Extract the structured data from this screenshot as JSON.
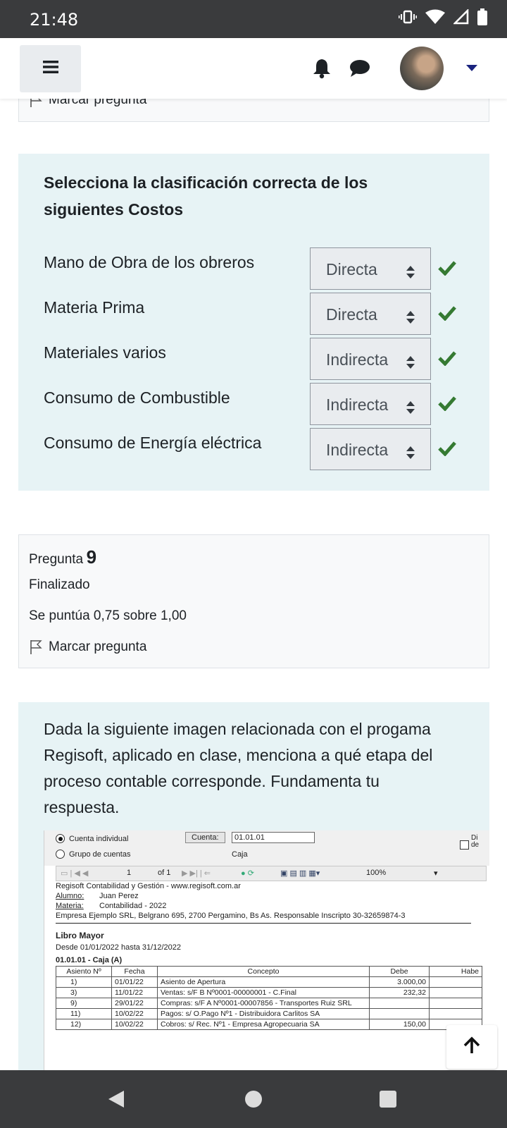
{
  "status_bar": {
    "time": "21:48",
    "icons": [
      "vibrate-icon",
      "wifi-icon",
      "signal-icon",
      "battery-icon"
    ]
  },
  "top_nav": {
    "menu_icon": "hamburger-icon",
    "icons": [
      "bell-icon",
      "chat-icon",
      "avatar",
      "caret-down-icon"
    ]
  },
  "prev_card": {
    "flag_label": "Marcar pregunta"
  },
  "question8": {
    "text": "Selecciona la clasificación correcta de los siguientes Costos",
    "rows": [
      {
        "label": "Mano de Obra de los obreros",
        "value": "Directa"
      },
      {
        "label": "Materia Prima",
        "value": "Directa"
      },
      {
        "label": "Materiales varios",
        "value": "Indirecta"
      },
      {
        "label": "Consumo de Combustible",
        "value": "Indirecta"
      },
      {
        "label": "Consumo de Energía eléctrica",
        "value": "Indirecta"
      }
    ],
    "check_color": "#357a32"
  },
  "info9": {
    "pregunta_label": "Pregunta",
    "number": "9",
    "state": "Finalizado",
    "grade": "Se puntúa 0,75 sobre 1,00",
    "flag_label": "Marcar pregunta"
  },
  "question9": {
    "text": "Dada la siguiente imagen relacionada con el progama Regisoft, aplicado en clase, menciona a qué etapa del proceso contable corresponde. Fundamenta tu respuesta.",
    "screenshot": {
      "radio_individual": "Cuenta individual",
      "radio_grupo": "Grupo de cuentas",
      "cuenta_btn": "Cuenta:",
      "cuenta_value": "01.01.01",
      "cuenta_name": "Caja",
      "side_cut": "Di de",
      "toolbar_page": "1",
      "toolbar_of": "of 1",
      "toolbar_zoom": "100%",
      "header_line": "Regisoft Contabilidad y Gestión  -  www.regisoft.com.ar",
      "alumno_label": "Alumno:",
      "alumno_value": "Juan Perez",
      "materia_label": "Materia:",
      "materia_value": "Contabilidad - 2022",
      "empresa_line": "Empresa Ejemplo SRL, Belgrano 695, 2700 Pergamino, Bs As.  Responsable Inscripto 30-32659874-3",
      "libro_title": "Libro Mayor",
      "desde_line": "Desde  01/01/2022  hasta  31/12/2022",
      "cuenta_line": "01.01.01 - Caja (A)",
      "columns": [
        "Asiento Nº",
        "Fecha",
        "Concepto",
        "Debe",
        "Habe"
      ],
      "rows": [
        [
          "1)",
          "01/01/22",
          "Asiento de Apertura",
          "3.000,00",
          ""
        ],
        [
          "3)",
          "11/01/22",
          "Ventas: s/F B Nº0001-00000001 - C.Final",
          "232,32",
          ""
        ],
        [
          "9)",
          "29/01/22",
          "Compras: s/F A Nº0001-00007856 - Transportes Ruiz SRL",
          "",
          ""
        ],
        [
          "11)",
          "10/02/22",
          "Pagos: s/ O.Pago Nº1 - Distribuidora Carlitos SA",
          "",
          ""
        ],
        [
          "12)",
          "10/02/22",
          "Cobros: s/ Rec. Nº1 - Empresa Agropecuaria SA",
          "150,00",
          ""
        ]
      ]
    }
  },
  "scroll_top_icon": "arrow-up-icon",
  "nav_bar": {
    "icons": [
      "back-icon",
      "home-icon",
      "recents-icon"
    ]
  }
}
